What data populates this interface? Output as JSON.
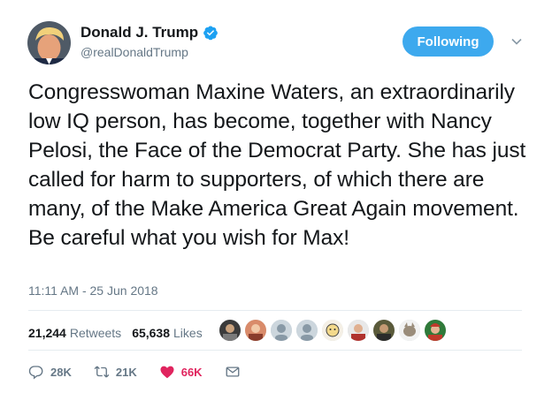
{
  "user": {
    "display_name": "Donald J. Trump",
    "handle": "@realDonaldTrump",
    "verified_icon": "verified-badge-icon"
  },
  "follow_button": {
    "label": "Following"
  },
  "menu": {
    "icon": "chevron-down-icon"
  },
  "tweet": {
    "text": "Congresswoman Maxine Waters, an extraordinarily low IQ person, has become, together with Nancy Pelosi, the Face of the Democrat Party. She has just called for harm to supporters, of which there are many, of the Make America Great Again movement. Be careful what you wish for Max!",
    "timestamp": "11:11 AM - 25 Jun 2018"
  },
  "stats": {
    "retweets_count": "21,244",
    "retweets_label": "Retweets",
    "likes_count": "65,638",
    "likes_label": "Likes"
  },
  "actions": {
    "reply_count": "28K",
    "retweet_count": "21K",
    "like_count": "66K"
  },
  "colors": {
    "accent": "#3da9ee",
    "like": "#e0245e",
    "muted": "#657786",
    "divider": "#e6ecf0"
  }
}
